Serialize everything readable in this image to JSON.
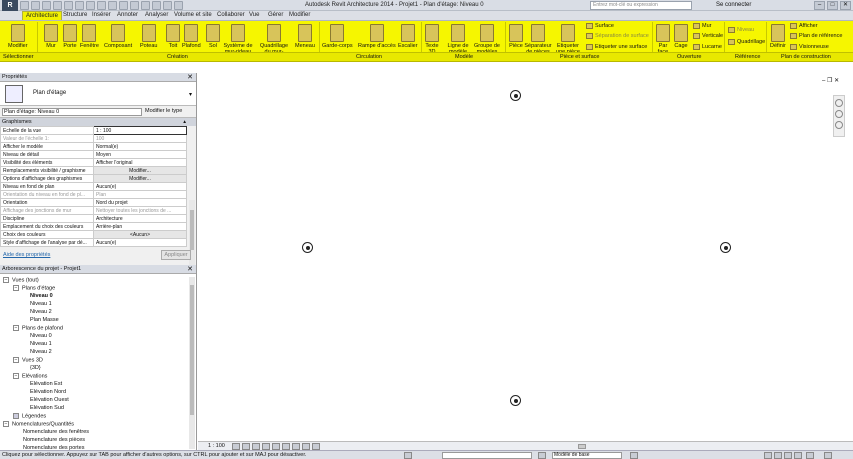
{
  "app": {
    "title": "Autodesk Revit Architecture 2014 - Projet1 - Plan d'étage: Niveau 0",
    "search_placeholder": "Entrez mot-clé ou expression",
    "signin": "Se connecter",
    "logo": "R"
  },
  "tabs": [
    "Architecture",
    "Structure",
    "Insérer",
    "Annoter",
    "Analyser",
    "Volume et site",
    "Collaborer",
    "Vue",
    "Gérer",
    "Modifier"
  ],
  "ribbon": {
    "modifier": "Modifier",
    "buttons": {
      "mur": "Mur",
      "porte": "Porte",
      "fenetre": "Fenêtre",
      "composant": "Composant",
      "poteau": "Poteau",
      "toit": "Toit",
      "plafond": "Plafond",
      "sol": "Sol",
      "systeme": "Système de mur-rideau",
      "quadrillage": "Quadrillage du mur-rideau",
      "meneau": "Meneau",
      "gardecorps": "Garde-corps",
      "rampe": "Rampe d'accès",
      "escalier": "Escalier",
      "texte3d": "Texte 3D",
      "ligne_modele": "Ligne de modèle",
      "groupe": "Groupe de modèles",
      "piece": "Pièce",
      "separateur": "Séparateur de pièces",
      "etiquette_piece": "Etiqueter une pièce",
      "par_face": "Par face",
      "cage": "Cage",
      "definir": "Définir"
    },
    "small": {
      "surface": "Surface",
      "separation_surface": "Séparation de surface",
      "etiqueter_surface": "Etiqueter une surface",
      "mur": "Mur",
      "verticale": "Verticale",
      "lucarne": "Lucarne",
      "niveau": "Niveau",
      "quadrillage": "Quadrillage",
      "afficher": "Afficher",
      "plan_reference": "Plan de référence",
      "visionneuse": "Visionneuse"
    },
    "panels": [
      "Sélectionner",
      "Création",
      "Circulation",
      "Modèle",
      "Pièce et surface",
      "Ouverture",
      "Référence",
      "Plan de construction"
    ]
  },
  "properties": {
    "header": "Propriétés",
    "type_name": "Plan d'étage",
    "instance": "Plan d'étage: Niveau 0",
    "edit_type": "Modifier le type",
    "group": "Graphismes",
    "rows": [
      [
        "Echelle de la vue",
        "1 : 100"
      ],
      [
        "Valeur de l'échelle    1:",
        "100"
      ],
      [
        "Afficher le modèle",
        "Normal(e)"
      ],
      [
        "Niveau de détail",
        "Moyen"
      ],
      [
        "Visibilité des éléments",
        "Afficher l'original"
      ],
      [
        "Remplacements visibilité / graphisme",
        "Modifier..."
      ],
      [
        "Options d'affichage des graphismes",
        "Modifier..."
      ],
      [
        "Niveau en fond de plan",
        "Aucun(e)"
      ],
      [
        "Orientation du niveau en fond de pl...",
        "Plan"
      ],
      [
        "Orientation",
        "Nord du projet"
      ],
      [
        "Affichage des jonctions de mur",
        "Nettoyer toutes les jonctions de ..."
      ],
      [
        "Discipline",
        "Architecture"
      ],
      [
        "Emplacement du choix des couleurs",
        "Arrière-plan"
      ],
      [
        "Choix des couleurs",
        "<Aucun>"
      ],
      [
        "Style d'affichage de l'analyse par dé...",
        "Aucun(e)"
      ]
    ],
    "help_link": "Aide des propriétés",
    "apply": "Appliquer"
  },
  "browser": {
    "header": "Arborescence du projet - Projet1",
    "items": [
      {
        "label": "Vues (tout)",
        "level": 0,
        "box": "−"
      },
      {
        "label": "Plans d'étage",
        "level": 1,
        "box": "−"
      },
      {
        "label": "Niveau 0",
        "level": 2,
        "bold": true
      },
      {
        "label": "Niveau 1",
        "level": 2
      },
      {
        "label": "Niveau 2",
        "level": 2
      },
      {
        "label": "Plan Masse",
        "level": 2
      },
      {
        "label": "Plans de plafond",
        "level": 1,
        "box": "−"
      },
      {
        "label": "Niveau 0",
        "level": 2
      },
      {
        "label": "Niveau 1",
        "level": 2
      },
      {
        "label": "Niveau 2",
        "level": 2
      },
      {
        "label": "Vues 3D",
        "level": 1,
        "box": "−"
      },
      {
        "label": "{3D}",
        "level": 2
      },
      {
        "label": "Elévations",
        "level": 1,
        "box": "−"
      },
      {
        "label": "Elévation Est",
        "level": 2
      },
      {
        "label": "Elévation Nord",
        "level": 2
      },
      {
        "label": "Elévation Ouest",
        "level": 2
      },
      {
        "label": "Elévation Sud",
        "level": 2
      },
      {
        "label": "Légendes",
        "level": 0
      },
      {
        "label": "Nomenclatures/Quantités",
        "level": 0,
        "box": "−"
      },
      {
        "label": "Nomenclature des fenêtres",
        "level": 1
      },
      {
        "label": "Nomenclature des pièces",
        "level": 1
      },
      {
        "label": "Nomenclature des portes",
        "level": 1
      }
    ]
  },
  "viewbar": {
    "scale": "1 : 100"
  },
  "status": {
    "text": "Cliquez pour sélectionner. Appuyez sur TAB pour afficher d'autres options, sur CTRL pour ajouter et sur MAJ pour désactiver.",
    "model": "Modèle de base"
  }
}
